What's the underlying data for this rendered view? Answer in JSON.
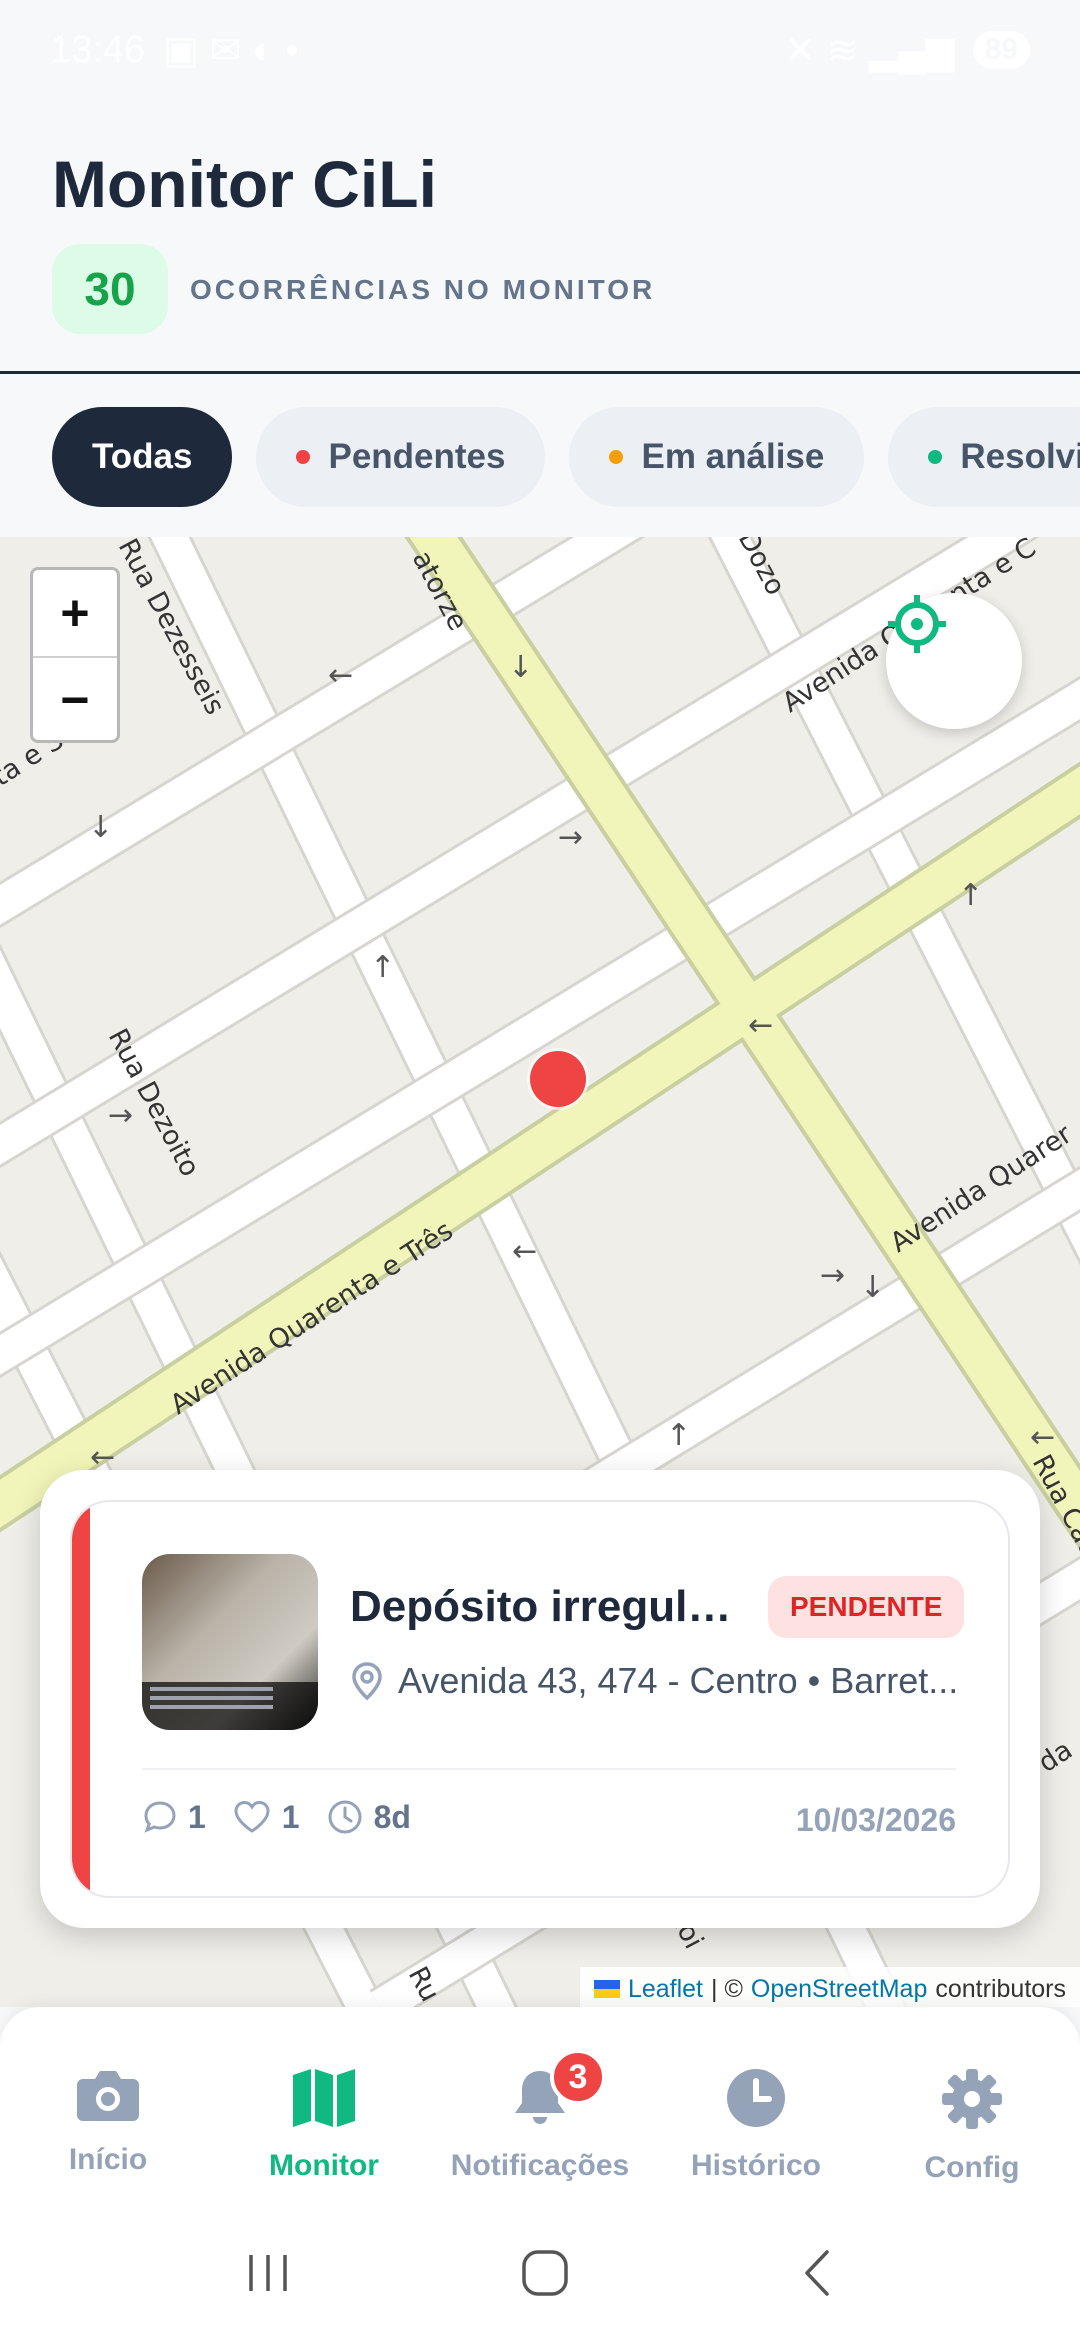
{
  "status_bar": {
    "time": "13:46",
    "battery": "89"
  },
  "header": {
    "title": "Monitor CiLi",
    "count": "30",
    "count_label": "OCORRÊNCIAS NO MONITOR"
  },
  "filters": [
    {
      "label": "Todas",
      "active": true
    },
    {
      "label": "Pendentes",
      "dot_color": "#ef4444"
    },
    {
      "label": "Em análise",
      "dot_color": "#f59e0b"
    },
    {
      "label": "Resolvi",
      "dot_color": "#10b981"
    }
  ],
  "map": {
    "zoom_in": "+",
    "zoom_out": "−",
    "streets": {
      "s1": "atorze",
      "s2": "Dozo",
      "s3": "Rua Dezesseis",
      "s4": "Avenida Quarenta e C",
      "s5": "ta e Sete",
      "s6": "Rua Dezoito",
      "s7": "Avenida Quarenta e Três",
      "s8": "Avenida Quarer",
      "s9": "Rua Cator",
      "s10": "zoi",
      "s11": "Ru",
      "s12": "da"
    },
    "attribution": {
      "leaflet": "Leaflet",
      "sep": "| ©",
      "osm": "OpenStreetMap",
      "contributors": "contributors"
    }
  },
  "card": {
    "title": "Depósito irregular...",
    "status": "PENDENTE",
    "address": "Avenida 43, 474 - Centro • Barret...",
    "comments": "1",
    "likes": "1",
    "age": "8d",
    "date": "10/03/2026"
  },
  "bottom_nav": [
    {
      "label": "Início",
      "icon": "camera-icon"
    },
    {
      "label": "Monitor",
      "icon": "map-icon",
      "active": true
    },
    {
      "label": "Notificações",
      "icon": "bell-icon",
      "badge": "3"
    },
    {
      "label": "Histórico",
      "icon": "clock-icon"
    },
    {
      "label": "Config",
      "icon": "gear-icon"
    }
  ],
  "colors": {
    "accent": "#10b981",
    "pending": "#ef4444",
    "analysis": "#f59e0b",
    "dark": "#1e293b"
  }
}
